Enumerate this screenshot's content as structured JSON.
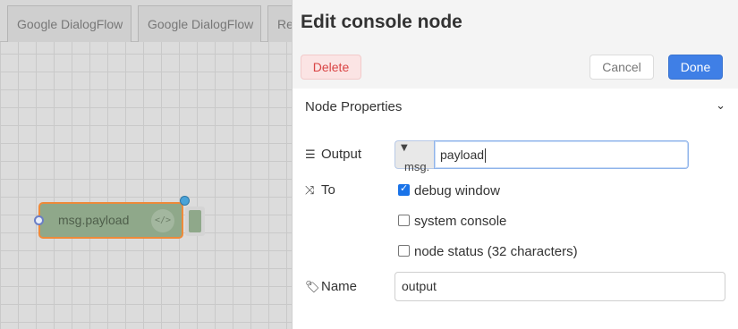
{
  "workspace": {
    "tabs": [
      {
        "label": "Google DialogFlow"
      },
      {
        "label": "Google DialogFlow"
      },
      {
        "label": "Re"
      }
    ],
    "node": {
      "label": "msg.payload",
      "icon": "code-icon"
    }
  },
  "tray": {
    "title": "Edit console node",
    "delete_label": "Delete",
    "cancel_label": "Cancel",
    "done_label": "Done",
    "section_title": "Node Properties",
    "output": {
      "label": "Output",
      "type_prefix": "msg.",
      "value": "payload"
    },
    "to": {
      "label": "To",
      "options": [
        {
          "label": "debug window",
          "checked": true
        },
        {
          "label": "system console",
          "checked": false
        },
        {
          "label": "node status (32 characters)",
          "checked": false
        }
      ]
    },
    "name": {
      "label": "Name",
      "value": "output"
    }
  },
  "colors": {
    "done_button": "#3f7fe6",
    "delete_text": "#d94444",
    "node_fill": "#8fa88a",
    "node_border": "#ee8a3a"
  }
}
